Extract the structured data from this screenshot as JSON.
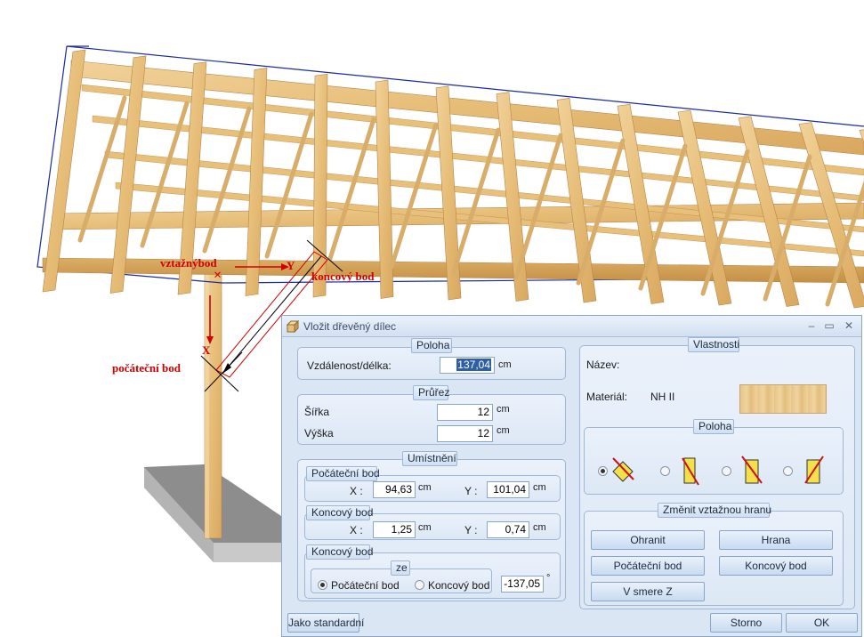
{
  "scene": {
    "annotations": {
      "reference_point": "vztažnýbod",
      "end_point": "koncový bod",
      "start_point": "počáteční bod",
      "axis_y": "Y",
      "axis_x": "X",
      "marker": "×"
    }
  },
  "dialog": {
    "title": "Vložit dřevěný dílec",
    "window_buttons": {
      "minimize": "–",
      "maximize": "▭",
      "close": "✕"
    },
    "poloha": {
      "title": "Poloha",
      "distance_label": "Vzdálenost/délka:",
      "distance_value": "137,04",
      "unit": "cm"
    },
    "prurez": {
      "title": "Průřez",
      "width_label": "Šířka",
      "width_value": "12",
      "height_label": "Výška",
      "height_value": "12",
      "unit": "cm"
    },
    "umisteni": {
      "title": "Umístnění",
      "start": {
        "title": "Počáteční bod",
        "x_label": "X :",
        "x_value": "94,63",
        "y_label": "Y :",
        "y_value": "101,04",
        "unit": "cm"
      },
      "end": {
        "title": "Koncový bod",
        "x_label": "X :",
        "x_value": "1,25",
        "y_label": "Y :",
        "y_value": "0,74",
        "unit": "cm"
      },
      "end2": {
        "title": "Koncový bod",
        "from_title": "ze",
        "option_start": "Počáteční bod",
        "option_end": "Koncový bod",
        "selected": "Počáteční bod",
        "angle_value": "-137,05",
        "angle_unit": "°"
      }
    },
    "vlastnosti": {
      "title": "Vlastnosti",
      "name_label": "Název:",
      "name_value": "",
      "material_label": "Materiál:",
      "material_value": "NH II",
      "poloha_title": "Poloha",
      "position_options_count": 4,
      "selected_position": 1
    },
    "edge": {
      "title": "Změnit vztažnou hranu",
      "buttons": {
        "ohranit": "Ohranit",
        "hrana": "Hrana",
        "pocatecni": "Počáteční bod",
        "koncovy": "Koncový bod",
        "v_smere_z": "V smere Z"
      }
    },
    "footer": {
      "default_button": "Jako standardní",
      "cancel_button": "Storno",
      "ok_button": "OK"
    },
    "colors": {
      "dialog_bg": "#dbe6f4",
      "panel_border": "#9fb6d6",
      "selection": "#2f5ea8",
      "annotation_red": "#d40000",
      "wood": "#e9c07a"
    }
  }
}
